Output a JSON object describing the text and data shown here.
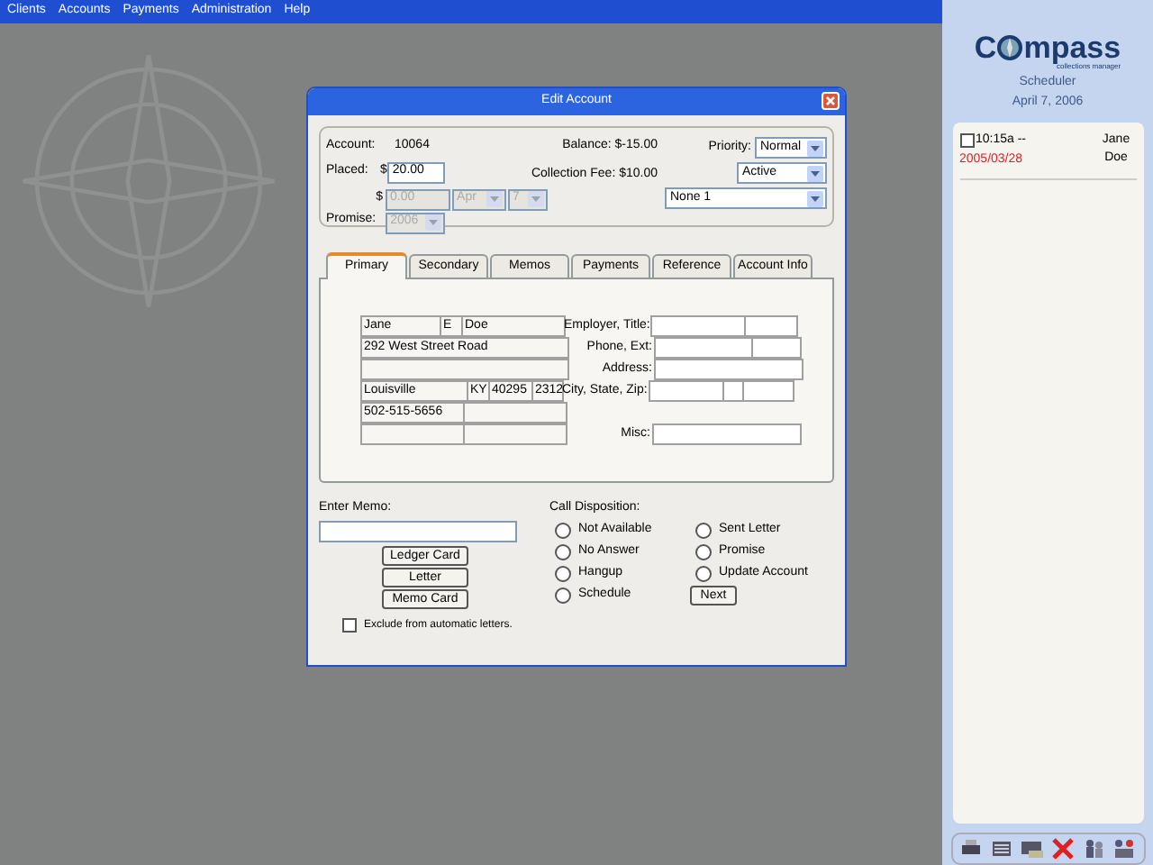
{
  "menu": [
    "Clients",
    "Accounts",
    "Payments",
    "Administration",
    "Help"
  ],
  "dialog": {
    "title": "Edit Account",
    "account_label": "Account:",
    "account": "10064",
    "balance": "Balance: $-15.00",
    "priority_label": "Priority:",
    "priority": "Normal",
    "placed_label": "Placed:",
    "placed_currency": "$",
    "placed": "20.00",
    "collection_fee": "Collection Fee: $10.00",
    "status": "Active",
    "promise_label": "Promise:",
    "promise_currency": "$",
    "promise_amount": "0.00",
    "promise_month": "Apr",
    "promise_day": "7",
    "promise_year": "2006",
    "promise_disabled": true,
    "group": "None 1",
    "tabs": [
      {
        "label": "Primary",
        "selected": true
      },
      {
        "label": "Secondary",
        "selected": false
      },
      {
        "label": "Memos",
        "selected": false
      },
      {
        "label": "Payments",
        "selected": false
      },
      {
        "label": "Reference",
        "selected": false
      },
      {
        "label": "Account Info",
        "selected": false
      }
    ],
    "primary": {
      "first_name": "Jane",
      "middle_initial": "E",
      "last_name": "Doe",
      "address": "292 West Street Road",
      "city": "Louisville",
      "state": "KY",
      "zip": "40295",
      "zip_ext": "2312",
      "phone": "502-515-5656",
      "right_labels": [
        "Employer, Title:",
        "Phone, Ext:",
        "Address:",
        "City, State, Zip:",
        "Misc:"
      ]
    },
    "memo_label": "Enter Memo:",
    "memo_buttons": [
      "Ledger Card",
      "Letter",
      "Memo Card"
    ],
    "exclude": {
      "label": "Exclude from automatic letters.",
      "checked": false
    },
    "disposition_label": "Call Disposition:",
    "dispositions": [
      {
        "label": "Not Available",
        "selected": false
      },
      {
        "label": "No Answer",
        "selected": false
      },
      {
        "label": "Hangup",
        "selected": false
      },
      {
        "label": "Schedule",
        "selected": false
      },
      {
        "label": "Sent Letter",
        "selected": false
      },
      {
        "label": "Promise",
        "selected": false
      },
      {
        "label": "Update Account",
        "selected": false
      }
    ],
    "next_button": "Next"
  },
  "sidebar": {
    "logo_start": "C",
    "logo_end": "mpass",
    "logo_tagline": "collections manager",
    "section": "Scheduler",
    "date": "April 7, 2006",
    "appointments": [
      {
        "checked": false,
        "time": "10:15a --",
        "date": "2005/03/28",
        "name": "Jane Doe"
      }
    ]
  }
}
